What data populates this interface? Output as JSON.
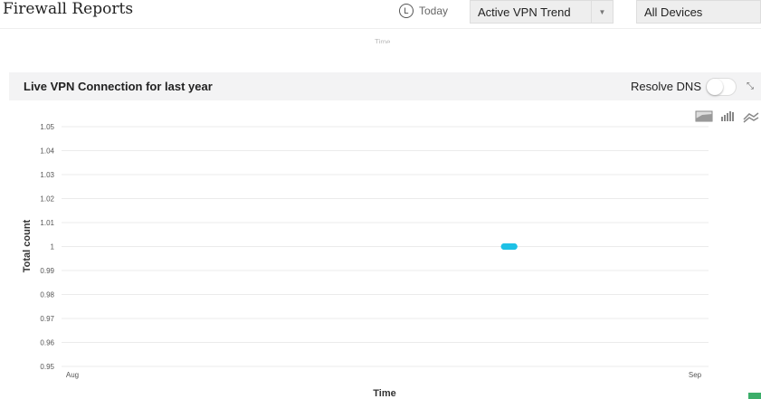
{
  "header": {
    "title": "Firewall Reports",
    "today_label": "Today",
    "clock_glyph": "L",
    "report_select": "Active VPN Trend",
    "device_select": "All Devices",
    "ghost_axis": "Time"
  },
  "panel": {
    "title": "Live VPN Connection for last year",
    "resolve_dns_label": "Resolve DNS",
    "resolve_dns_on": false
  },
  "colors": {
    "series": "#1ec1e6",
    "grid": "#ebebeb"
  },
  "chart_data": {
    "type": "line",
    "title": "Live VPN Connection for last year",
    "xlabel": "Time",
    "ylabel": "Total count",
    "x_ticks": [
      {
        "label": "Aug",
        "day": 0
      },
      {
        "label": "Sep",
        "day": 31
      }
    ],
    "xlim_days": [
      0,
      31
    ],
    "ylim": [
      0.95,
      1.05
    ],
    "y_ticks": [
      "0.95",
      "0.96",
      "0.97",
      "0.98",
      "0.99",
      "1",
      "1.01",
      "1.02",
      "1.03",
      "1.04",
      "1.05"
    ],
    "grid": true,
    "series": [
      {
        "name": "Total count",
        "points": [
          {
            "day": 21.5,
            "value": 1
          },
          {
            "day": 22,
            "value": 1
          }
        ]
      }
    ]
  }
}
